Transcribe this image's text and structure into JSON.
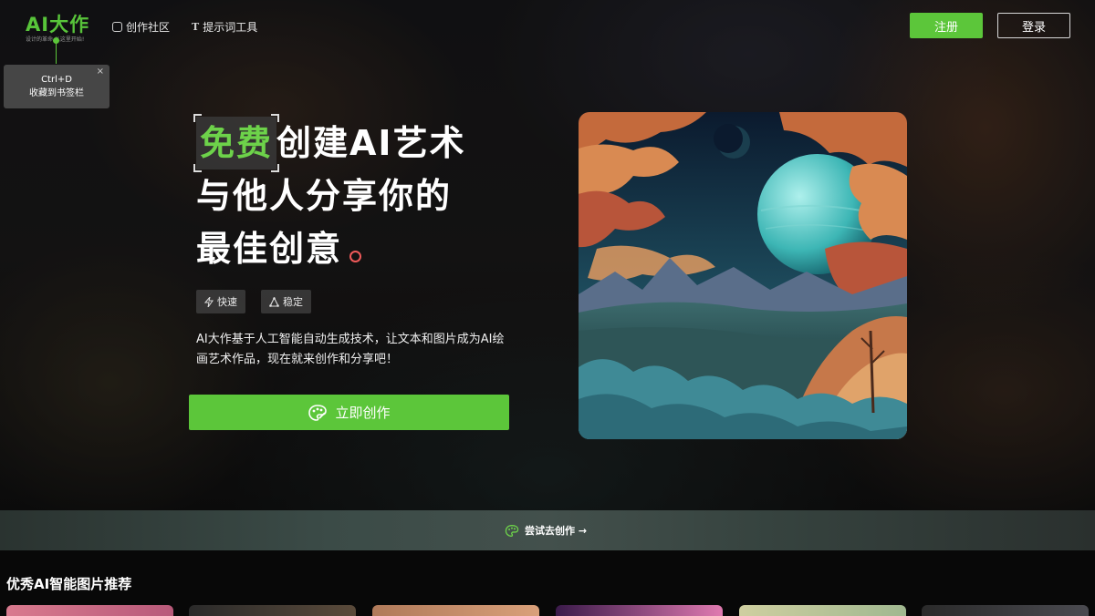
{
  "header": {
    "logo_title": "AI大作",
    "logo_subtitle": "设计的革命 从这里开始!",
    "nav": [
      {
        "label": "创作社区",
        "icon": "community-icon"
      },
      {
        "label": "提示词工具",
        "icon": "prompt-tool-icon"
      }
    ],
    "register_label": "注册",
    "login_label": "登录"
  },
  "bookmark_tip": {
    "shortcut": "Ctrl+D",
    "text": "收藏到书签栏",
    "close": "×"
  },
  "hero": {
    "highlight": "免费",
    "line1_rest": "创建AI艺术",
    "line2": "与他人分享你的",
    "line3": "最佳创意",
    "tags": [
      {
        "label": "快速",
        "icon": "lightning-icon"
      },
      {
        "label": "稳定",
        "icon": "triangle-nodes-icon"
      }
    ],
    "description": "AI大作基于人工智能自动生成技术，让文本和图片成为AI绘画艺术作品，现在就来创作和分享吧！",
    "cta_label": "立即创作"
  },
  "strip": {
    "link_label": "尝试去创作 →"
  },
  "recommend": {
    "title": "优秀AI智能图片推荐"
  },
  "colors": {
    "accent": "#5cc63a",
    "highlight_text": "#6dd24a",
    "ring": "#f05a5a"
  }
}
